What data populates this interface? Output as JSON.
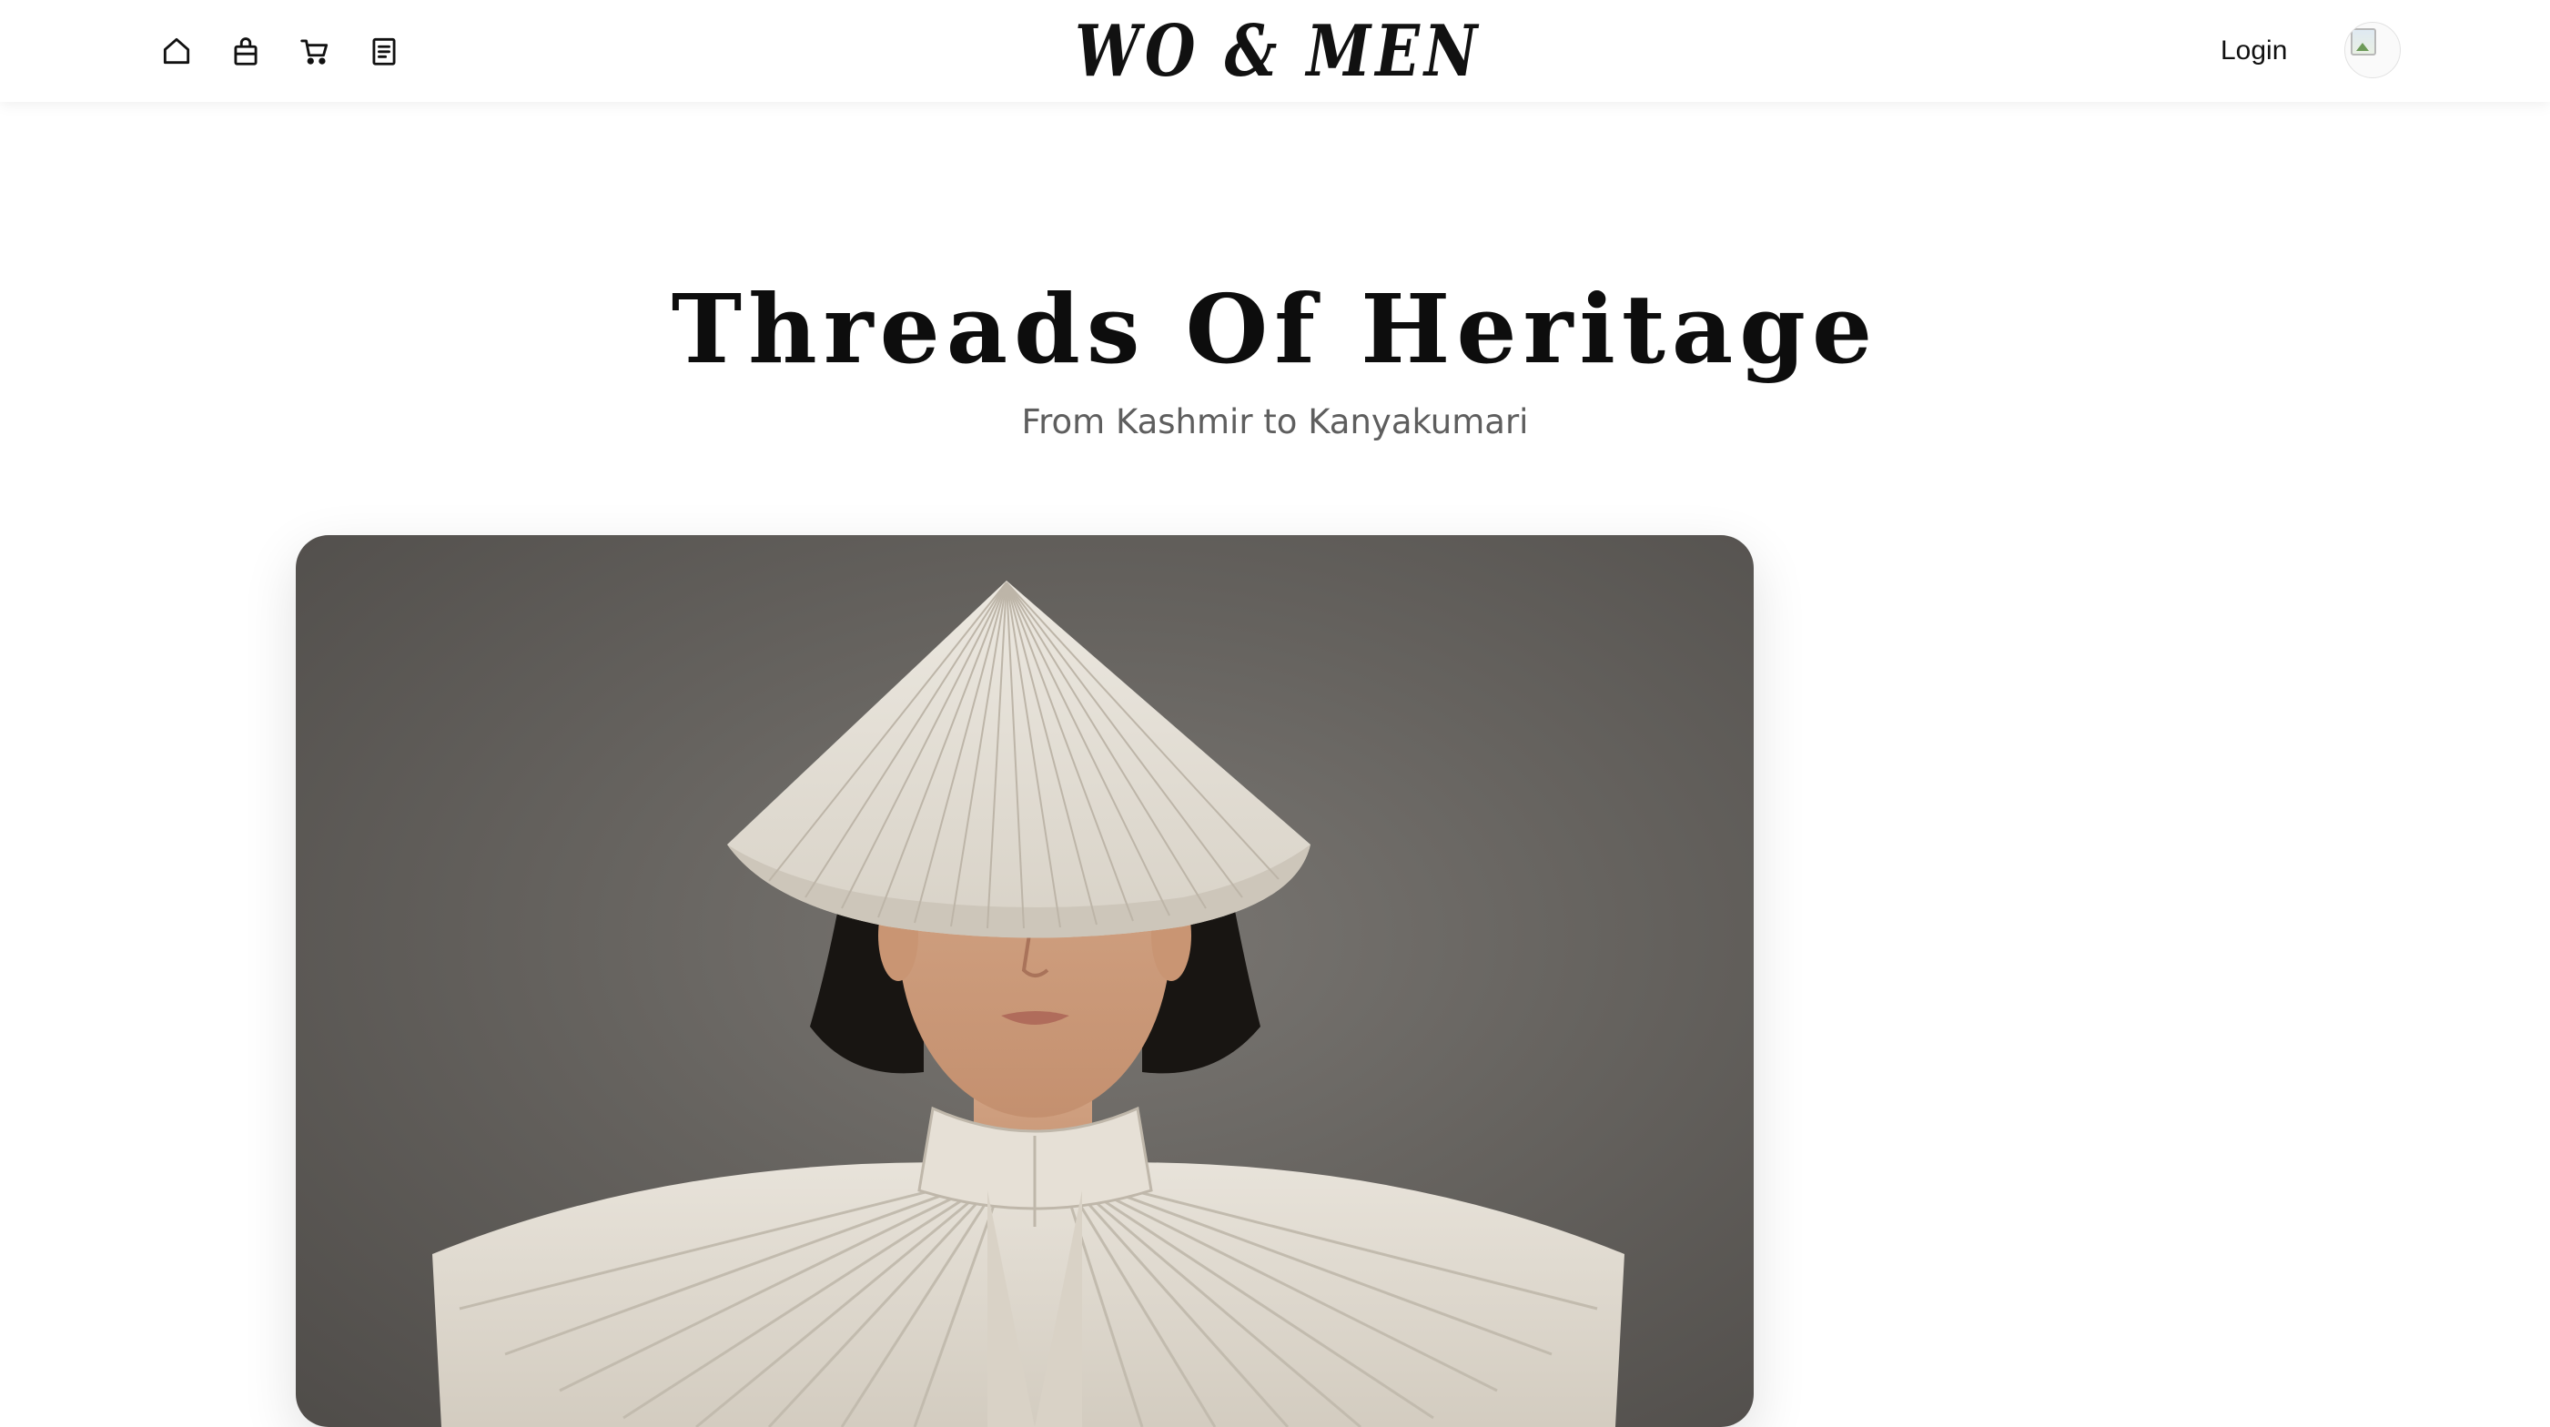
{
  "header": {
    "nav_icons": [
      "home-icon",
      "shopping-bag-icon",
      "cart-icon",
      "orders-icon"
    ],
    "logo_text": "WO & MEN",
    "login_label": "Login"
  },
  "hero": {
    "title": "Threads Of Heritage",
    "subtitle": "From Kashmir to Kanyakumari"
  },
  "colors": {
    "background": "#ffffff",
    "text": "#111111",
    "subtitle": "#5e5e5e",
    "card_backdrop": "#66635f",
    "garment": "#e4dfd6"
  }
}
